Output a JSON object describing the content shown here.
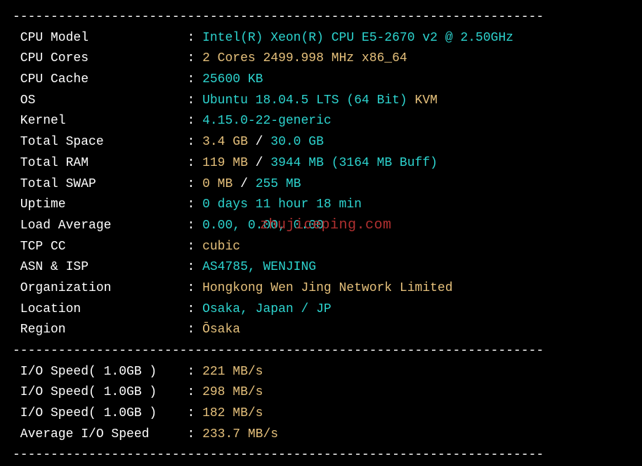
{
  "divider": "----------------------------------------------------------------------",
  "rows": [
    {
      "label": "CPU Model",
      "value": [
        {
          "text": "Intel(R) Xeon(R) CPU E5-2670 v2 @ 2.50GHz",
          "class": "cyan"
        }
      ]
    },
    {
      "label": "CPU Cores",
      "value": [
        {
          "text": "2 Cores 2499.998 MHz x86_64",
          "class": "yellow"
        }
      ]
    },
    {
      "label": "CPU Cache",
      "value": [
        {
          "text": "25600 KB",
          "class": "cyan"
        }
      ]
    },
    {
      "label": "OS",
      "value": [
        {
          "text": "Ubuntu 18.04.5 LTS (64 Bit)",
          "class": "cyan"
        },
        {
          "text": " KVM",
          "class": "yellow"
        }
      ]
    },
    {
      "label": "Kernel",
      "value": [
        {
          "text": "4.15.0-22-generic",
          "class": "cyan"
        }
      ]
    },
    {
      "label": "Total Space",
      "value": [
        {
          "text": "3.4 GB",
          "class": "yellow"
        },
        {
          "text": " / ",
          "class": "white"
        },
        {
          "text": "30.0 GB",
          "class": "cyan"
        }
      ]
    },
    {
      "label": "Total RAM",
      "value": [
        {
          "text": "119 MB",
          "class": "yellow"
        },
        {
          "text": " / ",
          "class": "white"
        },
        {
          "text": "3944 MB",
          "class": "cyan"
        },
        {
          "text": " (3164 MB Buff)",
          "class": "cyan"
        }
      ]
    },
    {
      "label": "Total SWAP",
      "value": [
        {
          "text": "0 MB",
          "class": "yellow"
        },
        {
          "text": " / ",
          "class": "white"
        },
        {
          "text": "255 MB",
          "class": "cyan"
        }
      ]
    },
    {
      "label": "Uptime",
      "value": [
        {
          "text": "0 days 11 hour 18 min",
          "class": "cyan"
        }
      ]
    },
    {
      "label": "Load Average",
      "value": [
        {
          "text": "0.00, 0.00, 0.00",
          "class": "cyan"
        }
      ]
    },
    {
      "label": "TCP CC",
      "value": [
        {
          "text": "cubic",
          "class": "yellow"
        }
      ]
    },
    {
      "label": "ASN & ISP",
      "value": [
        {
          "text": "AS4785, WENJING",
          "class": "cyan"
        }
      ]
    },
    {
      "label": "Organization",
      "value": [
        {
          "text": "Hongkong Wen Jing Network Limited",
          "class": "yellow"
        }
      ]
    },
    {
      "label": "Location",
      "value": [
        {
          "text": "Osaka, Japan / JP",
          "class": "cyan"
        }
      ]
    },
    {
      "label": "Region",
      "value": [
        {
          "text": "Ōsaka",
          "class": "yellow"
        }
      ]
    }
  ],
  "io_rows": [
    {
      "label": "I/O Speed( 1.0GB )",
      "value": [
        {
          "text": "221 MB/s",
          "class": "yellow"
        }
      ]
    },
    {
      "label": "I/O Speed( 1.0GB )",
      "value": [
        {
          "text": "298 MB/s",
          "class": "yellow"
        }
      ]
    },
    {
      "label": "I/O Speed( 1.0GB )",
      "value": [
        {
          "text": "182 MB/s",
          "class": "yellow"
        }
      ]
    },
    {
      "label": "Average I/O Speed",
      "value": [
        {
          "text": "233.7 MB/s",
          "class": "yellow"
        }
      ]
    }
  ],
  "watermark": "zhujiceping.com"
}
